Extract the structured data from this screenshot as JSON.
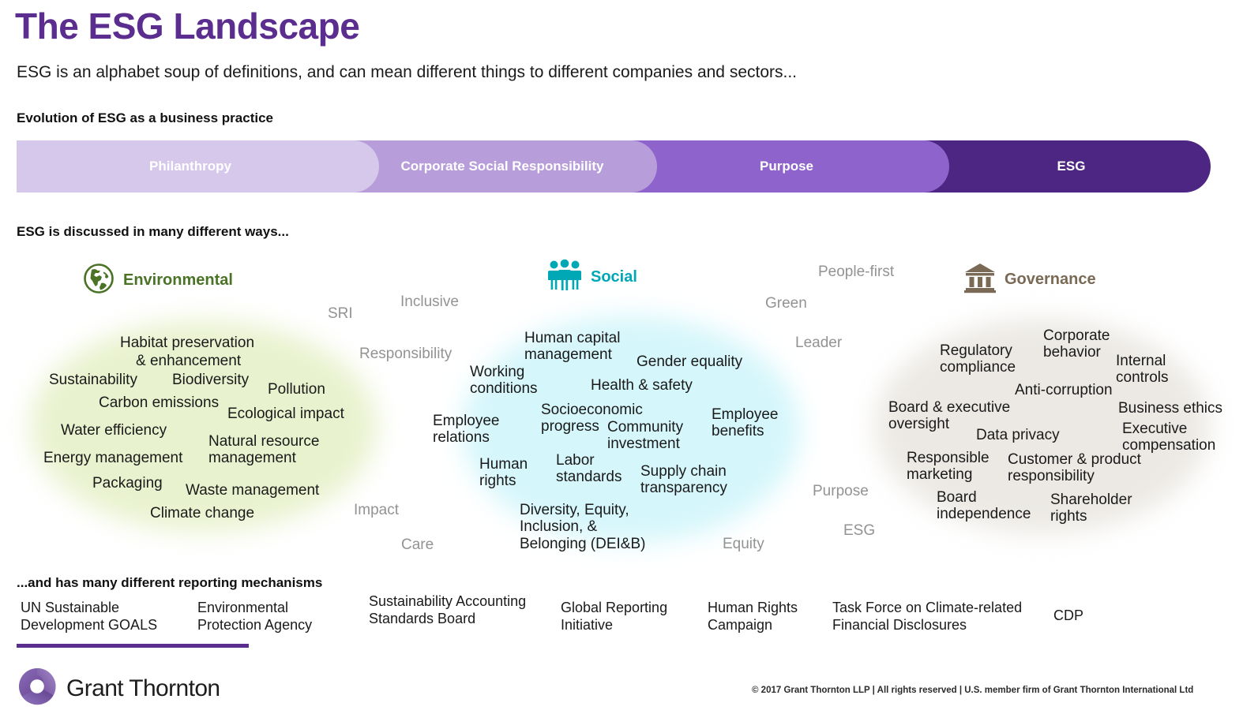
{
  "header": {
    "title": "The ESG Landscape",
    "subtitle": "ESG is an alphabet soup of definitions, and can mean different things to different companies and sectors...",
    "title_color": "#5b2d8e"
  },
  "evolution": {
    "heading": "Evolution of ESG as a business practice",
    "segments": [
      {
        "label": "Philanthropy",
        "color": "#d5c8ea"
      },
      {
        "label": "Corporate Social\nResponsibility",
        "color": "#b89ddb"
      },
      {
        "label": "Purpose",
        "color": "#8e63cb"
      },
      {
        "label": "ESG",
        "color": "#4d2583"
      }
    ]
  },
  "ways": {
    "heading": "ESG is discussed in many different ways...",
    "pillars": [
      {
        "name": "Environmental",
        "icon": "globe-icon",
        "color": "#4a7326",
        "bubble_color": "#e9f2cf",
        "terms": [
          "Habitat preservation",
          "& enhancement",
          "Sustainability",
          "Biodiversity",
          "Pollution",
          "Carbon emissions",
          "Ecological impact",
          "Water efficiency",
          "Natural resource\nmanagement",
          "Energy management",
          "Packaging",
          "Waste management",
          "Climate change"
        ]
      },
      {
        "name": "Social",
        "icon": "three-people-icon",
        "color": "#00a7b5",
        "bubble_color": "#d5f6fb",
        "terms": [
          "Human capital\nmanagement",
          "Gender equality",
          "Working\nconditions",
          "Health & safety",
          "Socioeconomic\nprogress",
          "Community\ninvestment",
          "Employee\nbenefits",
          "Employee\nrelations",
          "Human\nrights",
          "Labor\nstandards",
          "Supply chain\ntransparency",
          "Diversity, Equity,\nInclusion, &\nBelonging (DEI&B)"
        ]
      },
      {
        "name": "Governance",
        "icon": "bank-icon",
        "color": "#7a6a55",
        "bubble_color": "#ece9e4",
        "terms": [
          "Corporate\nbehavior",
          "Regulatory\ncompliance",
          "Internal\ncontrols",
          "Anti-corruption",
          "Board & executive\noversight",
          "Business ethics",
          "Data privacy",
          "Executive\ncompensation",
          "Responsible\nmarketing",
          "Customer & product\nresponsibility",
          "Board\nindependence",
          "Shareholder\nrights"
        ]
      }
    ],
    "ghost_terms": [
      "SRI",
      "Inclusive",
      "Responsibility",
      "Impact",
      "Care",
      "People-first",
      "Green",
      "Leader",
      "Purpose",
      "ESG",
      "Equity"
    ]
  },
  "reporting": {
    "heading": "...and has many different reporting mechanisms",
    "items": [
      "UN Sustainable\nDevelopment GOALS",
      "Environmental\nProtection Agency",
      "Sustainability Accounting\nStandards Board",
      "Global Reporting\nInitiative",
      "Human Rights\nCampaign",
      "Task Force on Climate-related\nFinancial Disclosures",
      "CDP"
    ],
    "underline_color": "#5b2d8e"
  },
  "footer": {
    "logo_text": "Grant Thornton",
    "copyright": "© 2017 Grant Thornton LLP  |  All rights reserved  | U.S. member firm of Grant Thornton International Ltd"
  }
}
